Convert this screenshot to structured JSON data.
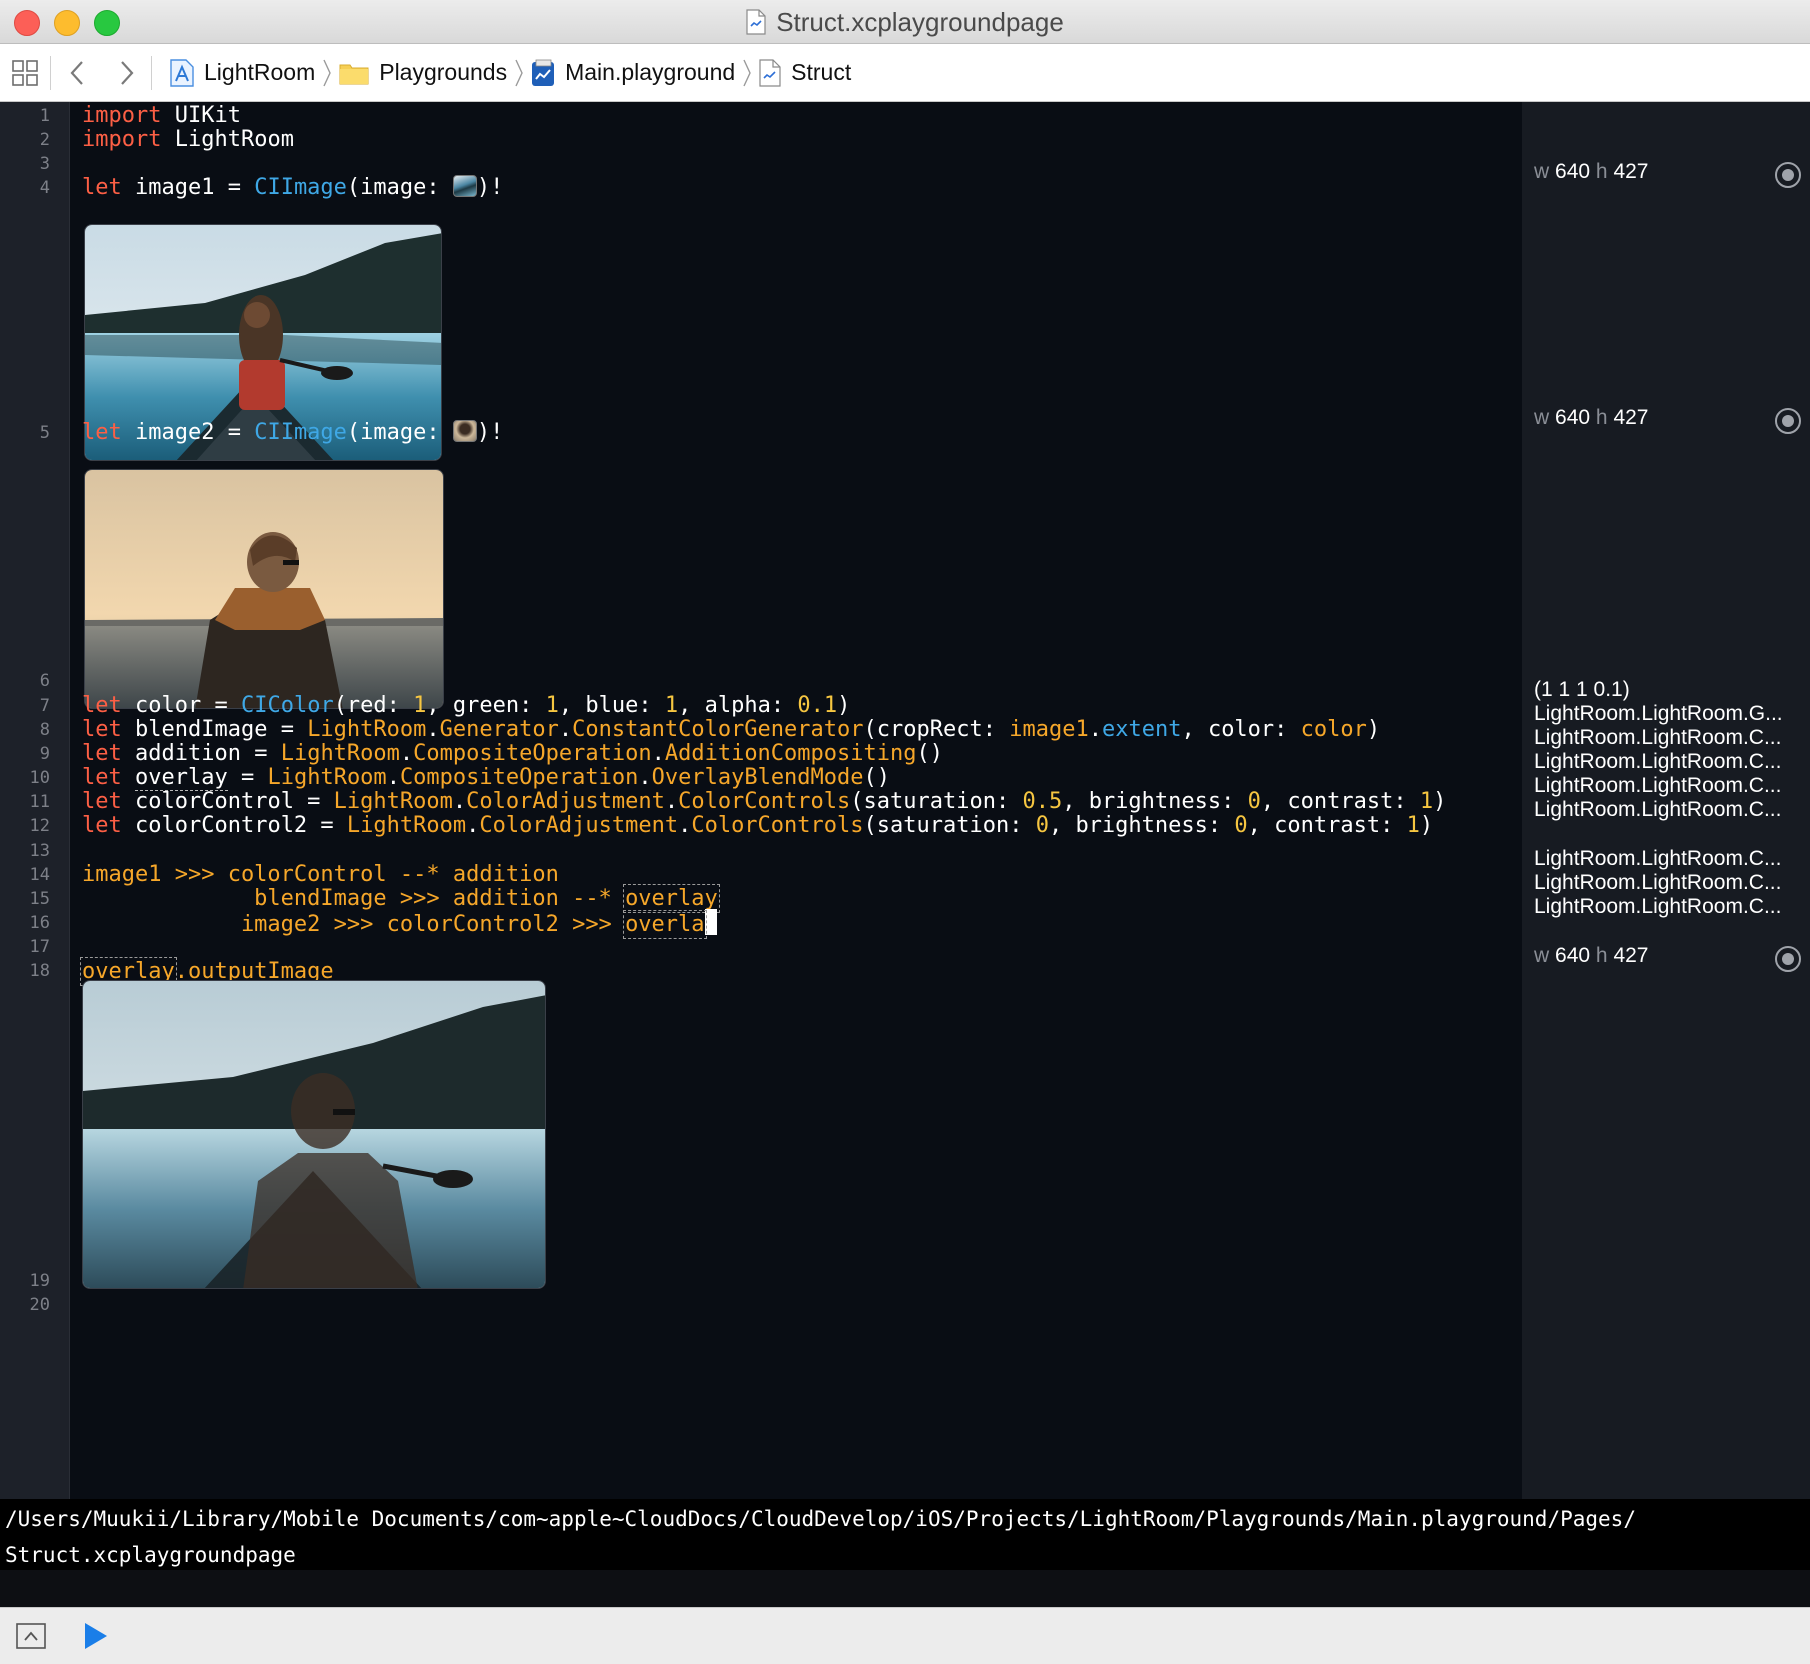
{
  "window": {
    "title": "Struct.xcplaygroundpage"
  },
  "breadcrumb": [
    {
      "label": "LightRoom",
      "icon": "project-icon"
    },
    {
      "label": "Playgrounds",
      "icon": "folder-icon"
    },
    {
      "label": "Main.playground",
      "icon": "playground-icon"
    },
    {
      "label": "Struct",
      "icon": "playground-page-icon"
    }
  ],
  "line_numbers": [
    "1",
    "2",
    "3",
    "4",
    "5",
    "6",
    "7",
    "8",
    "9",
    "10",
    "11",
    "12",
    "13",
    "14",
    "15",
    "16",
    "17",
    "18",
    "19",
    "20"
  ],
  "code": {
    "l1": {
      "kw": "import",
      "rest": " UIKit"
    },
    "l2": {
      "kw": "import",
      "rest": " LightRoom"
    },
    "l4": {
      "kw": "let",
      "name": " image1 = ",
      "type": "CIImage",
      "arg": "(image: ",
      "end": ")!"
    },
    "l5": {
      "kw": "let",
      "name": " image2 = ",
      "type": "CIImage",
      "arg": "(image: ",
      "end": ")!"
    },
    "l7": {
      "kw": "let",
      "a": " color = ",
      "type": "CIColor",
      "b": "(red: ",
      "n1": "1",
      "c": ", green: ",
      "n2": "1",
      "d": ", blue: ",
      "n3": "1",
      "e": ", alpha: ",
      "n4": "0.1",
      "f": ")"
    },
    "l8": {
      "kw": "let",
      "a": " blendImage = ",
      "p1": "LightRoom",
      "dot1": ".",
      "p2": "Generator",
      "dot2": ".",
      "p3": "ConstantColorGenerator",
      "b": "(cropRect: ",
      "p4": "image1",
      "dot3": ".",
      "p5": "extent",
      "c": ", color: ",
      "p6": "color",
      "d": ")"
    },
    "l9": {
      "kw": "let",
      "a": " addition = ",
      "p1": "LightRoom",
      "dot1": ".",
      "p2": "CompositeOperation",
      "dot2": ".",
      "p3": "AdditionCompositing",
      "b": "()"
    },
    "l10": {
      "kw": "let",
      "sp": " ",
      "name": "overlay",
      "a": " = ",
      "p1": "LightRoom",
      "dot1": ".",
      "p2": "CompositeOperation",
      "dot2": ".",
      "p3": "OverlayBlendMode",
      "b": "()"
    },
    "l11": {
      "kw": "let",
      "a": " colorControl = ",
      "p1": "LightRoom",
      "dot1": ".",
      "p2": "ColorAdjustment",
      "dot2": ".",
      "p3": "ColorControls",
      "b": "(saturation: ",
      "n1": "0.5",
      "c": ", brightness: ",
      "n2": "0",
      "d": ", contrast: ",
      "n3": "1",
      "e": ")"
    },
    "l12": {
      "kw": "let",
      "a": " colorControl2 = ",
      "p1": "LightRoom",
      "dot1": ".",
      "p2": "ColorAdjustment",
      "dot2": ".",
      "p3": "ColorControls",
      "b": "(saturation: ",
      "n1": "0",
      "c": ", brightness: ",
      "n2": "0",
      "d": ", contrast: ",
      "n3": "1",
      "e": ")"
    },
    "l14": {
      "text": "image1 >>> colorControl --* addition"
    },
    "l15": {
      "text": "             blendImage >>> addition --* ",
      "tok": "overlay"
    },
    "l16": {
      "text": "            image2 >>> colorControl2 >>> ",
      "tok": "overla"
    },
    "l18": {
      "tok": "overlay",
      "rest": ".outputImage"
    }
  },
  "results": {
    "r4": {
      "w_label": "w",
      "w": "640",
      "h_label": "h",
      "h": "427"
    },
    "r5": {
      "w_label": "w",
      "w": "640",
      "h_label": "h",
      "h": "427"
    },
    "r7": "(1 1 1 0.1)",
    "r8": "LightRoom.LightRoom.G...",
    "r9": "LightRoom.LightRoom.C...",
    "r10": "LightRoom.LightRoom.C...",
    "r11": "LightRoom.LightRoom.C...",
    "r12": "LightRoom.LightRoom.C...",
    "r14": "LightRoom.LightRoom.C...",
    "r15": "LightRoom.LightRoom.C...",
    "r16": "LightRoom.LightRoom.C...",
    "r18": {
      "w_label": "w",
      "w": "640",
      "h_label": "h",
      "h": "427"
    }
  },
  "console": {
    "line1": "/Users/Muukii/Library/Mobile Documents/com~apple~CloudDocs/CloudDevelop/iOS/Projects/LightRoom/Playgrounds/Main.playground/Pages/",
    "line2": "Struct.xcplaygroundpage"
  },
  "colors": {
    "keyword": "#fc5f45",
    "type": "#3fa8e6",
    "project_symbol": "#f6a72a",
    "number": "#f6c641",
    "editor_bg": "#090d14",
    "results_bg": "#171b22",
    "run_button": "#1a7ee8"
  }
}
